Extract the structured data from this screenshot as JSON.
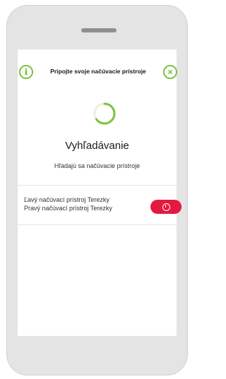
{
  "header": {
    "title": "Pripojte svoje načúvacie prístroje",
    "info_icon": "i",
    "close_icon": "×"
  },
  "search": {
    "title": "Vyhľadávanie",
    "subtitle": "Hľadajú sa načúvacie prístroje"
  },
  "devices": {
    "left": "Ľavý načúvací prístroj Terezky",
    "right": "Pravý načúvací prístroj Terezky"
  },
  "colors": {
    "accent_green": "#7dc242",
    "pair_red": "#e3193f"
  },
  "icons": {
    "info": "info-icon",
    "close": "close-icon",
    "spinner": "loading-spinner-icon",
    "power": "power-icon"
  }
}
